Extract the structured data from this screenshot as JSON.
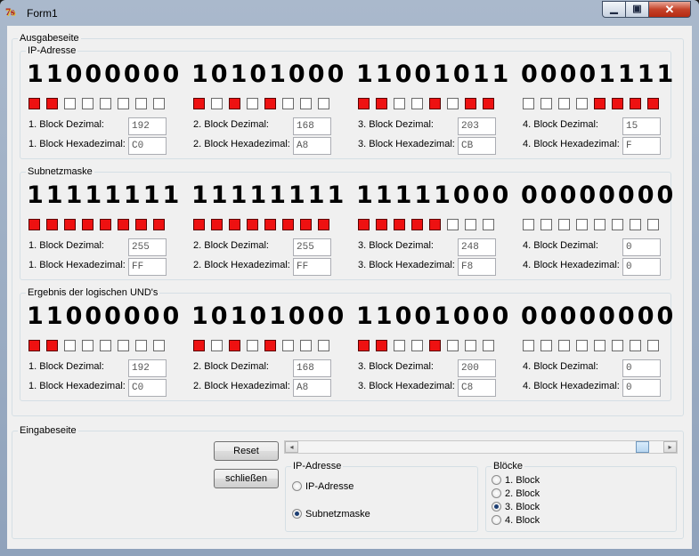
{
  "window": {
    "title": "Form1",
    "controls": {
      "minimize": "▁",
      "maximize": "▣",
      "close": "✕"
    }
  },
  "ausgabe": {
    "title": "Ausgabeseite"
  },
  "sections": [
    {
      "title": "IP-Adresse",
      "blocks": [
        {
          "binary": "11000000",
          "bits": [
            1,
            1,
            0,
            0,
            0,
            0,
            0,
            0
          ],
          "dec_label": "1. Block Dezimal:",
          "hex_label": "1. Block Hexadezimal:",
          "dec": "192",
          "hex": "C0"
        },
        {
          "binary": "10101000",
          "bits": [
            1,
            0,
            1,
            0,
            1,
            0,
            0,
            0
          ],
          "dec_label": "2. Block Dezimal:",
          "hex_label": "2. Block Hexadezimal:",
          "dec": "168",
          "hex": "A8"
        },
        {
          "binary": "11001011",
          "bits": [
            1,
            1,
            0,
            0,
            1,
            0,
            1,
            1
          ],
          "dec_label": "3. Block Dezimal:",
          "hex_label": "3. Block Hexadezimal:",
          "dec": "203",
          "hex": "CB"
        },
        {
          "binary": "00001111",
          "bits": [
            0,
            0,
            0,
            0,
            1,
            1,
            1,
            1
          ],
          "dec_label": "4. Block Dezimal:",
          "hex_label": "4. Block Hexadezimal:",
          "dec": "15",
          "hex": "F"
        }
      ]
    },
    {
      "title": "Subnetzmaske",
      "blocks": [
        {
          "binary": "11111111",
          "bits": [
            1,
            1,
            1,
            1,
            1,
            1,
            1,
            1
          ],
          "dec_label": "1. Block Dezimal:",
          "hex_label": "1. Block Hexadezimal:",
          "dec": "255",
          "hex": "FF"
        },
        {
          "binary": "11111111",
          "bits": [
            1,
            1,
            1,
            1,
            1,
            1,
            1,
            1
          ],
          "dec_label": "2. Block Dezimal:",
          "hex_label": "2. Block Hexadezimal:",
          "dec": "255",
          "hex": "FF"
        },
        {
          "binary": "11111000",
          "bits": [
            1,
            1,
            1,
            1,
            1,
            0,
            0,
            0
          ],
          "dec_label": "3. Block Dezimal:",
          "hex_label": "3. Block Hexadezimal:",
          "dec": "248",
          "hex": "F8"
        },
        {
          "binary": "00000000",
          "bits": [
            0,
            0,
            0,
            0,
            0,
            0,
            0,
            0
          ],
          "dec_label": "4. Block Dezimal:",
          "hex_label": "4. Block Hexadezimal:",
          "dec": "0",
          "hex": "0"
        }
      ]
    },
    {
      "title": "Ergebnis der logischen UND's",
      "blocks": [
        {
          "binary": "11000000",
          "bits": [
            1,
            1,
            0,
            0,
            0,
            0,
            0,
            0
          ],
          "dec_label": "1. Block Dezimal:",
          "hex_label": "1. Block Hexadezimal:",
          "dec": "192",
          "hex": "C0"
        },
        {
          "binary": "10101000",
          "bits": [
            1,
            0,
            1,
            0,
            1,
            0,
            0,
            0
          ],
          "dec_label": "2. Block Dezimal:",
          "hex_label": "2. Block Hexadezimal:",
          "dec": "168",
          "hex": "A8"
        },
        {
          "binary": "11001000",
          "bits": [
            1,
            1,
            0,
            0,
            1,
            0,
            0,
            0
          ],
          "dec_label": "3. Block Dezimal:",
          "hex_label": "3. Block Hexadezimal:",
          "dec": "200",
          "hex": "C8"
        },
        {
          "binary": "00000000",
          "bits": [
            0,
            0,
            0,
            0,
            0,
            0,
            0,
            0
          ],
          "dec_label": "4. Block Dezimal:",
          "hex_label": "4. Block Hexadezimal:",
          "dec": "0",
          "hex": "0"
        }
      ]
    }
  ],
  "eingabe": {
    "title": "Eingabeseite",
    "reset_label": "Reset",
    "close_label": "schließen",
    "scroll": {
      "value_fraction": 0.96,
      "left_arrow": "◂",
      "right_arrow": "▸"
    },
    "ip_group": {
      "title": "IP-Adresse",
      "options": [
        {
          "label": "IP-Adresse",
          "selected": false
        },
        {
          "label": "Subnetzmaske",
          "selected": true
        }
      ]
    },
    "block_group": {
      "title": "Blöcke",
      "options": [
        {
          "label": "1. Block",
          "selected": false
        },
        {
          "label": "2. Block",
          "selected": false
        },
        {
          "label": "3. Block",
          "selected": true
        },
        {
          "label": "4. Block",
          "selected": false
        }
      ]
    }
  },
  "colors": {
    "bit_on": "#ee1111",
    "bit_off": "#ffffff"
  }
}
